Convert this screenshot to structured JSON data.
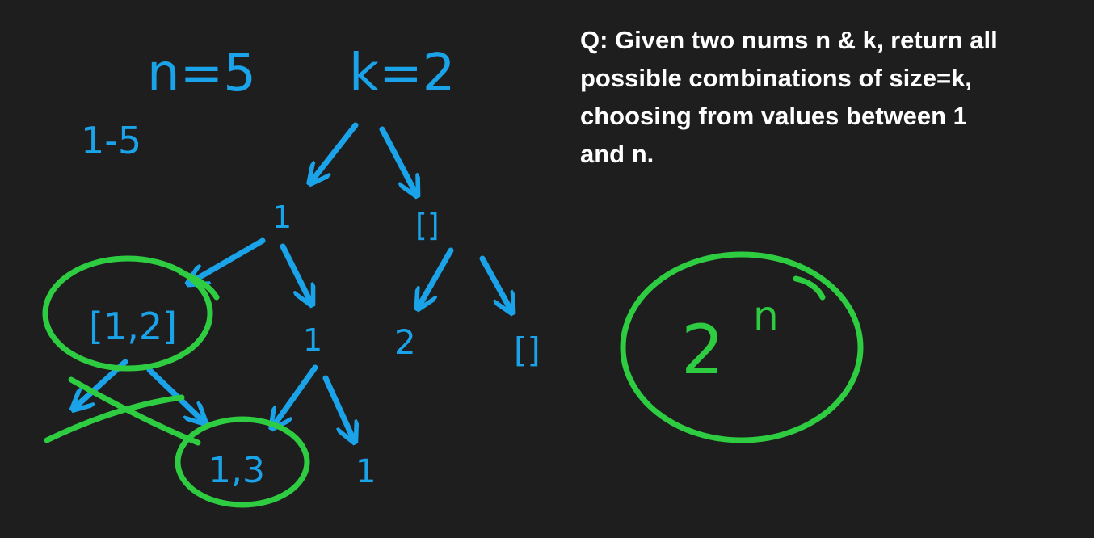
{
  "question": {
    "lines": [
      "Q: Given two nums n & k, return all",
      "possible combinations of size=k,",
      "choosing from values between 1",
      "and n."
    ]
  },
  "annotations": {
    "n_eq": "n=5",
    "k_eq": "k=2",
    "range": "1-5",
    "node_1": "1",
    "node_empty": "[]",
    "node_1_2": "[1,2]",
    "node_1b": "1",
    "node_2": "2",
    "node_empty2": "[]",
    "node_1_3": "1,3",
    "node_1c": "1",
    "complexity_base": "2",
    "complexity_exp": "n"
  },
  "colors": {
    "background": "#1e1e1e",
    "blue_ink": "#1aa3e8",
    "green_ink": "#2ecc40",
    "text": "#ffffff"
  }
}
